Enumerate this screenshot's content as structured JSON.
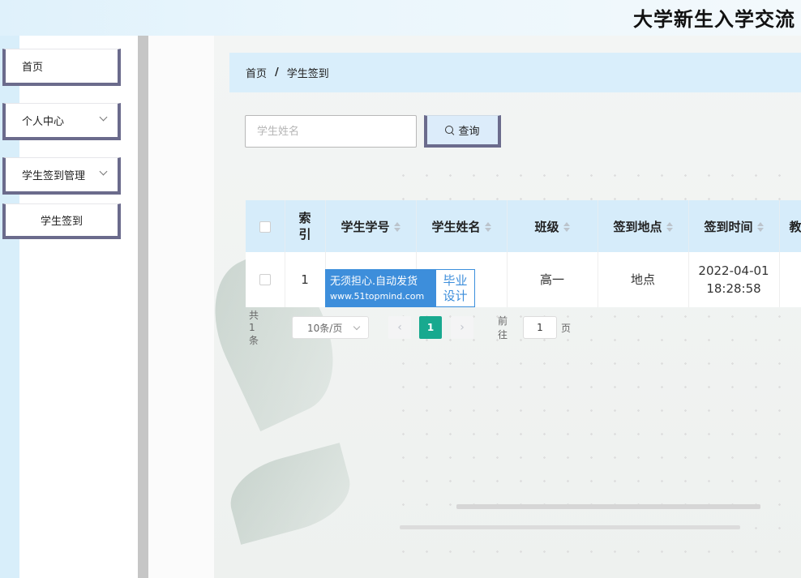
{
  "header": {
    "title": "大学新生入学交流"
  },
  "sidebar": {
    "items": [
      {
        "label": "首页"
      },
      {
        "label": "个人中心"
      },
      {
        "label": "学生签到管理"
      },
      {
        "label": "学生签到"
      }
    ]
  },
  "breadcrumb": {
    "home": "首页",
    "separator": "/",
    "current": "学生签到"
  },
  "search": {
    "placeholder": "学生姓名",
    "value": "",
    "button_label": "查询"
  },
  "table": {
    "columns": [
      "索引",
      "学生学号",
      "学生姓名",
      "班级",
      "签到地点",
      "签到时间",
      "教"
    ],
    "rows": [
      {
        "index": "1",
        "student_no": "",
        "student_name": "",
        "class": "高一",
        "location": "地点",
        "date": "2022-04-01",
        "time": "18:28:58"
      }
    ]
  },
  "watermark": {
    "line1": "无须担心.自动发货",
    "line2": "www.51topmind.com",
    "badge_line1": "毕业",
    "badge_line2": "设计"
  },
  "pagination": {
    "total": "共 1 条",
    "page_size": "10条/页",
    "current_page": "1",
    "goto_prefix": "前往",
    "goto_value": "1",
    "goto_suffix": "页"
  },
  "colors": {
    "accent": "#18a98f",
    "header_bg": "#d6ecfa",
    "menu_border": "#6b6b8c",
    "watermark_blue": "#3d8edb"
  }
}
